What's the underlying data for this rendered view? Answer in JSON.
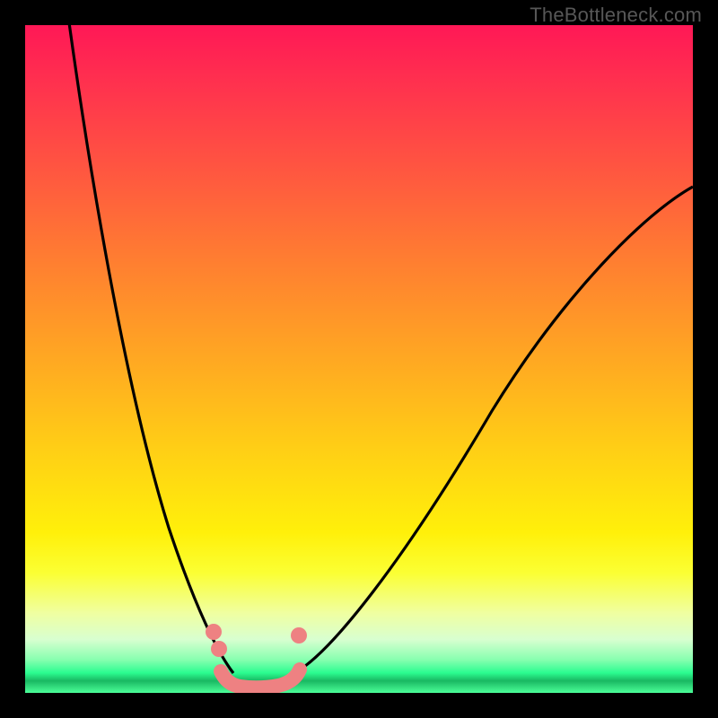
{
  "watermark": "TheBottleneck.com",
  "colors": {
    "gradient_top": "#ff1856",
    "gradient_mid": "#fff00a",
    "gradient_bottom": "#2bfc90",
    "curve": "#000000",
    "markers": "#ee8182",
    "frame": "#000000"
  },
  "chart_data": {
    "type": "line",
    "title": "",
    "xlabel": "",
    "ylabel": "",
    "xlim": [
      0,
      100
    ],
    "ylim": [
      0,
      100
    ],
    "grid": false,
    "legend": false,
    "background": "vertical-heat-gradient",
    "series": [
      {
        "name": "left_branch",
        "x": [
          6,
          10,
          15,
          20,
          25,
          28,
          30,
          31
        ],
        "y": [
          100,
          80,
          55,
          30,
          12,
          5,
          2,
          1
        ]
      },
      {
        "name": "right_branch",
        "x": [
          40,
          45,
          55,
          65,
          75,
          90,
          100
        ],
        "y": [
          2,
          5,
          20,
          40,
          55,
          70,
          76
        ]
      },
      {
        "name": "valley_floor",
        "x": [
          29,
          32,
          35,
          38,
          41
        ],
        "y": [
          3,
          1,
          0.5,
          1,
          3
        ]
      }
    ],
    "markers": [
      {
        "x": 28,
        "y": 9
      },
      {
        "x": 29,
        "y": 6
      },
      {
        "x": 41,
        "y": 8
      }
    ]
  }
}
